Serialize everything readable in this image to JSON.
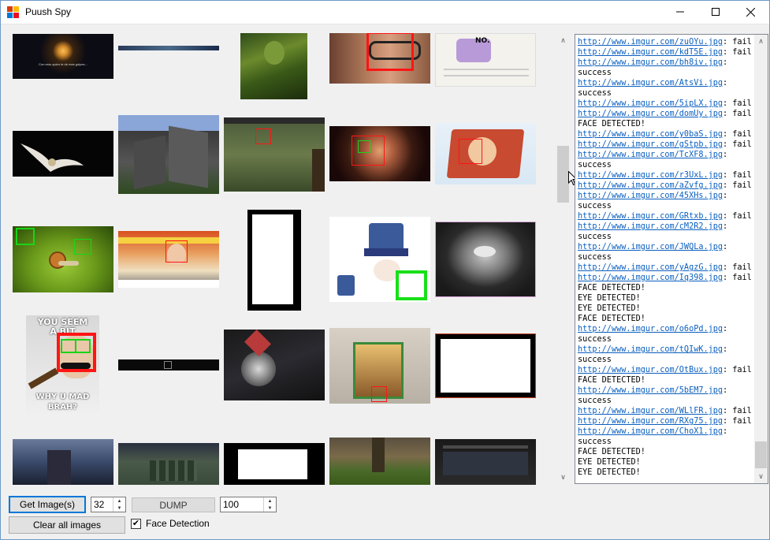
{
  "window": {
    "title": "Puush Spy",
    "minimize_glyph": "—",
    "maximize_glyph": "☐",
    "close_glyph": "✕"
  },
  "thumbnails": [
    {
      "name": "thumb-moon-caption",
      "icon": "photo-moon",
      "caption": "Con esto quien te de mes golpes..."
    },
    {
      "name": "thumb-banner-strip",
      "icon": "photo-banner"
    },
    {
      "name": "thumb-green-costume",
      "icon": "photo-costume"
    },
    {
      "name": "thumb-old-man-face",
      "icon": "photo-face",
      "detection": "face"
    },
    {
      "name": "thumb-pony-comic",
      "icon": "photo-comic"
    },
    {
      "name": "thumb-owl",
      "icon": "photo-owl"
    },
    {
      "name": "thumb-minecraft",
      "icon": "photo-minecraft"
    },
    {
      "name": "thumb-game-screenshot",
      "icon": "photo-game",
      "detection": "face"
    },
    {
      "name": "thumb-boy-face",
      "icon": "photo-boy",
      "detection": "face+eye"
    },
    {
      "name": "thumb-baby-cake",
      "icon": "photo-cake",
      "detection": "face"
    },
    {
      "name": "thumb-snail",
      "icon": "photo-snail",
      "detection": "eyes"
    },
    {
      "name": "thumb-news-reporter",
      "icon": "photo-reporter",
      "detection": "face"
    },
    {
      "name": "thumb-white-blank-tall",
      "icon": "photo-blank"
    },
    {
      "name": "thumb-facebook-cartoon",
      "icon": "photo-cartoon",
      "detection": "eye"
    },
    {
      "name": "thumb-cd-plate",
      "icon": "photo-plate"
    },
    {
      "name": "thumb-meme-groucho",
      "icon": "photo-meme",
      "detection": "face+eyes",
      "text_top": "YOU SEEM",
      "text_top2": "A BIT",
      "text_bottom": "WHY U MAD",
      "text_bottom2": "BRAH?"
    },
    {
      "name": "thumb-dark-strip",
      "icon": "photo-strip"
    },
    {
      "name": "thumb-vinyl-obsessed",
      "icon": "photo-vinyl"
    },
    {
      "name": "thumb-uncharted-box",
      "icon": "photo-gamebox",
      "detection": "face"
    },
    {
      "name": "thumb-white-blank-wide",
      "icon": "photo-blank"
    },
    {
      "name": "thumb-hallway",
      "icon": "photo-hallway"
    },
    {
      "name": "thumb-soldiers",
      "icon": "photo-soldiers"
    },
    {
      "name": "thumb-black-white",
      "icon": "photo-blank"
    },
    {
      "name": "thumb-mossy-tree",
      "icon": "photo-tree"
    },
    {
      "name": "thumb-dark-screenshot",
      "icon": "photo-screenshot"
    }
  ],
  "log": [
    {
      "url": "http://www.imgur.com/zuOYu.jpg",
      "suffix": ": fail"
    },
    {
      "url": "http://www.imgur.com/kdT5E.jpg",
      "suffix": ": fail"
    },
    {
      "url": "http://www.imgur.com/bh8iv.jpg",
      "suffix": ":"
    },
    {
      "text": "success"
    },
    {
      "url": "http://www.imgur.com/AtsVi.jpg",
      "suffix": ":"
    },
    {
      "text": "success"
    },
    {
      "url": "http://www.imgur.com/5ipLX.jpg",
      "suffix": ": fail"
    },
    {
      "url": "http://www.imgur.com/domUy.jpg",
      "suffix": ": fail"
    },
    {
      "text": "FACE DETECTED!"
    },
    {
      "url": "http://www.imgur.com/y0baS.jpg",
      "suffix": ": fail"
    },
    {
      "url": "http://www.imgur.com/gStpb.jpg",
      "suffix": ": fail"
    },
    {
      "url": "http://www.imgur.com/TcXF8.jpg",
      "suffix": ":"
    },
    {
      "text": "success"
    },
    {
      "url": "http://www.imgur.com/r3UxL.jpg",
      "suffix": ": fail"
    },
    {
      "url": "http://www.imgur.com/aZvfg.jpg",
      "suffix": ": fail"
    },
    {
      "url": "http://www.imgur.com/45XHs.jpg",
      "suffix": ":"
    },
    {
      "text": "success"
    },
    {
      "url": "http://www.imgur.com/GRtxb.jpg",
      "suffix": ": fail"
    },
    {
      "url": "http://www.imgur.com/cM2R2.jpg",
      "suffix": ":"
    },
    {
      "text": "success"
    },
    {
      "url": "http://www.imgur.com/JWQLa.jpg",
      "suffix": ":"
    },
    {
      "text": "success"
    },
    {
      "url": "http://www.imgur.com/yAgzG.jpg",
      "suffix": ": fail"
    },
    {
      "url": "http://www.imgur.com/Iq398.jpg",
      "suffix": ": fail"
    },
    {
      "text": "FACE DETECTED!"
    },
    {
      "text": "EYE DETECTED!"
    },
    {
      "text": "EYE DETECTED!"
    },
    {
      "text": "FACE DETECTED!"
    },
    {
      "url": "http://www.imgur.com/o6oPd.jpg",
      "suffix": ":"
    },
    {
      "text": "success"
    },
    {
      "url": "http://www.imgur.com/tQIwK.jpg",
      "suffix": ":"
    },
    {
      "text": "success"
    },
    {
      "url": "http://www.imgur.com/OtBux.jpg",
      "suffix": ": fail"
    },
    {
      "text": "FACE DETECTED!"
    },
    {
      "url": "http://www.imgur.com/5bEM7.jpg",
      "suffix": ":"
    },
    {
      "text": "success"
    },
    {
      "url": "http://www.imgur.com/WLlFR.jpg",
      "suffix": ": fail"
    },
    {
      "url": "http://www.imgur.com/RXg75.jpg",
      "suffix": ": fail"
    },
    {
      "url": "http://www.imgur.com/ChoX1.jpg",
      "suffix": ":"
    },
    {
      "text": "success"
    },
    {
      "text": "FACE DETECTED!"
    },
    {
      "text": "EYE DETECTED!"
    },
    {
      "text": "EYE DETECTED!"
    }
  ],
  "controls": {
    "get_images_label": "Get Image(s)",
    "count_value": "32",
    "dump_label": "DUMP",
    "limit_value": "100",
    "clear_label": "Clear all images",
    "face_detection_label": "Face Detection",
    "face_detection_checked": true,
    "check_glyph": "✔",
    "spin_up_glyph": "▲",
    "spin_down_glyph": "▼"
  },
  "scroll": {
    "up_glyph": "∧",
    "down_glyph": "∨",
    "images_position": 0.28,
    "log_position": 0.97
  },
  "colors": {
    "face_box": "#ff1515",
    "eye_box": "#19d419",
    "link": "#0b5fbf",
    "focus": "#0078d7"
  }
}
